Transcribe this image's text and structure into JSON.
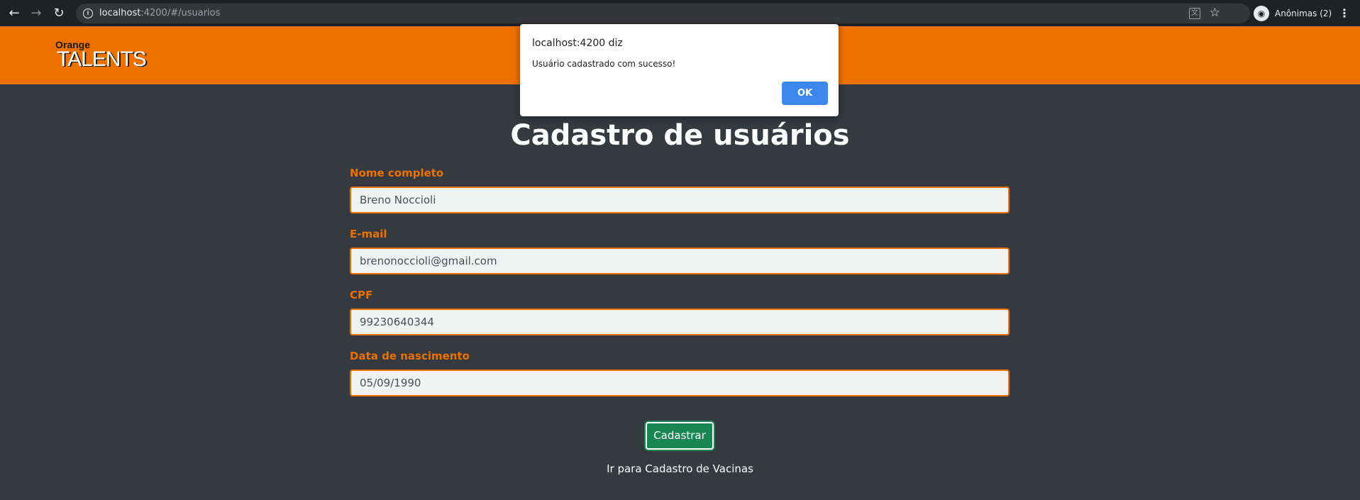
{
  "browser": {
    "url_host": "localhost",
    "url_rest": ":4200/#/usuarios",
    "profile_label": "Anônimas (2)",
    "icons": {
      "back": "arrow-back-icon",
      "forward": "arrow-forward-icon",
      "reload": "reload-icon",
      "info": "info-icon",
      "translate": "translate-icon",
      "star": "star-icon",
      "profile": "incognito-icon",
      "menu": "kebab-menu-icon"
    }
  },
  "header": {
    "logo_small": "Orange",
    "logo_big": "TALENTS",
    "background": "#ee7100"
  },
  "main": {
    "title": "Cadastro de usuários",
    "fields": [
      {
        "label": "Nome completo",
        "value": "Breno Noccioli"
      },
      {
        "label": "E-mail",
        "value": "brenonoccioli@gmail.com"
      },
      {
        "label": "CPF",
        "value": "99230640344"
      },
      {
        "label": "Data de nascimento",
        "value": "05/09/1990"
      }
    ],
    "submit_label": "Cadastrar",
    "link_label": "Ir para Cadastro de Vacinas"
  },
  "dialog": {
    "title": "localhost:4200 diz",
    "message": "Usuário cadastrado com sucesso!",
    "ok_label": "OK"
  },
  "colors": {
    "accent": "#ee7100",
    "page_bg": "#343a40",
    "success": "#198754",
    "dialog_button": "#1a73e8"
  }
}
